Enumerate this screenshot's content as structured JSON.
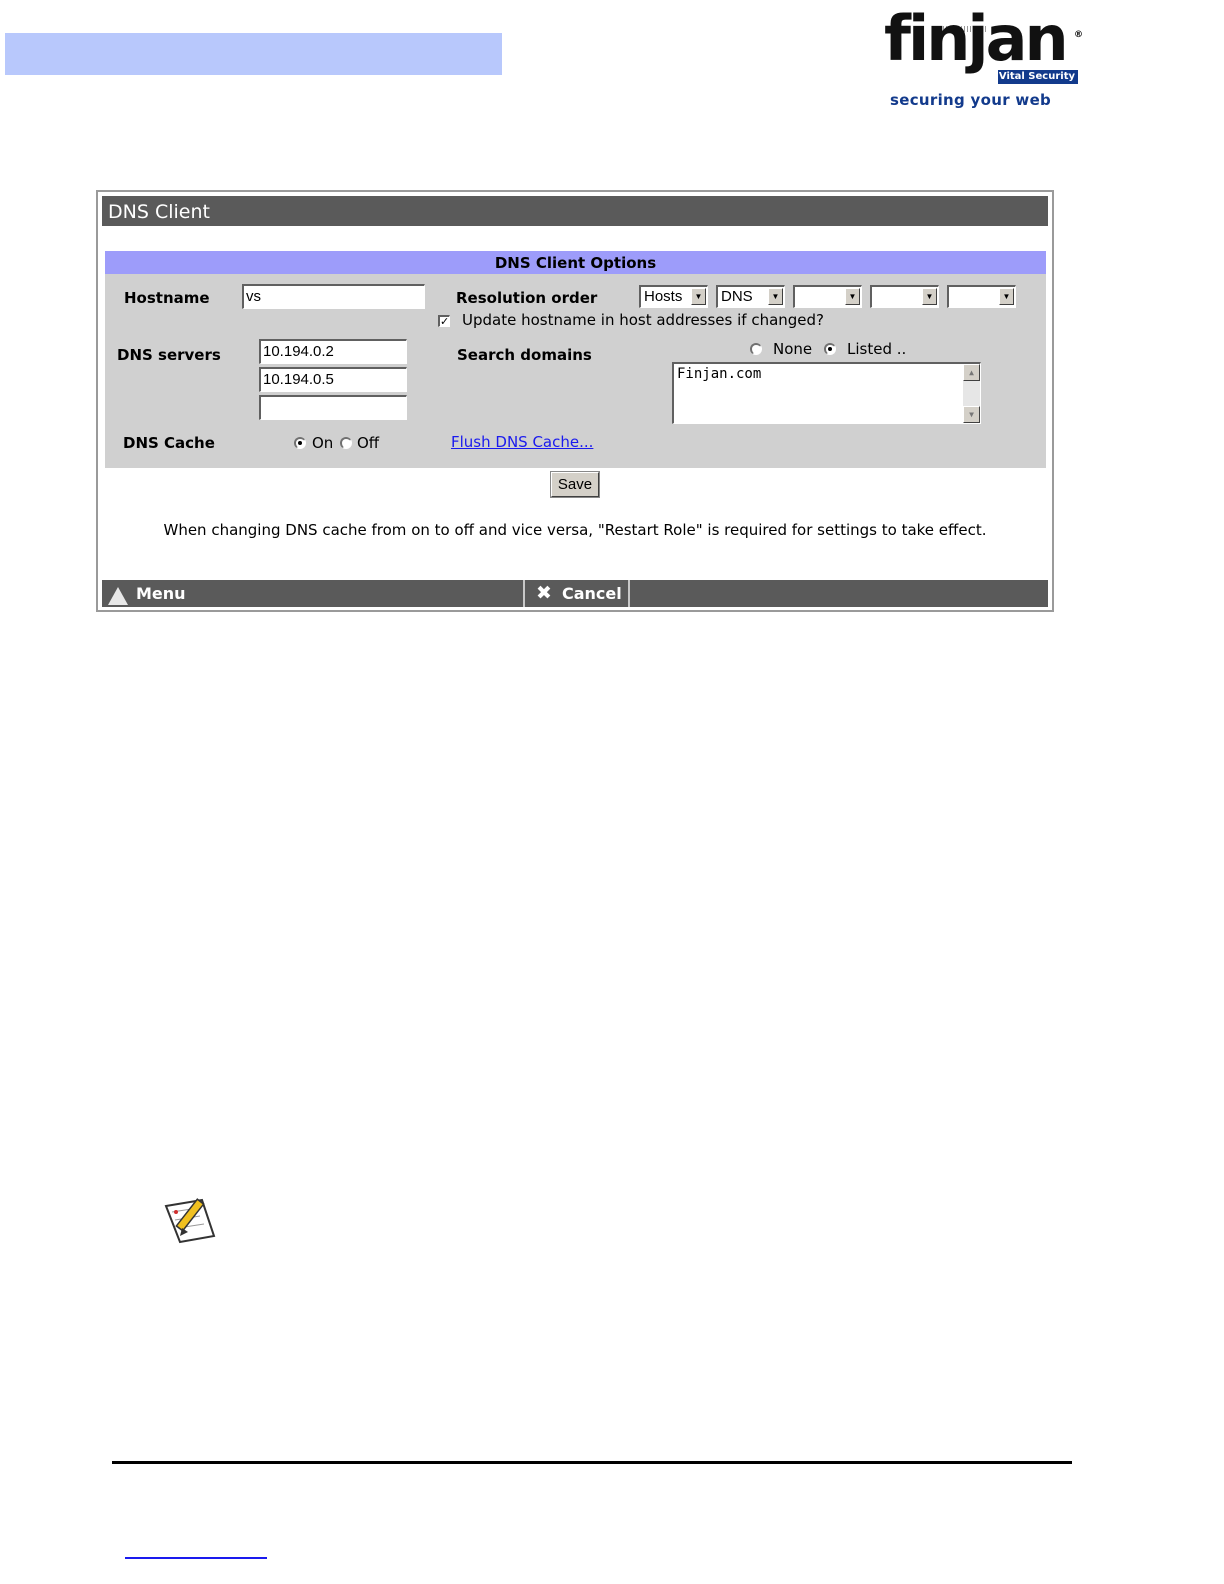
{
  "brand": {
    "name": "finjan",
    "badge": "Vital Security",
    "tagline": "securing your web"
  },
  "dialog": {
    "title": "DNS Client",
    "options_header": "DNS Client Options",
    "hostname": {
      "label": "Hostname",
      "value": "vs"
    },
    "resolution_order": {
      "label": "Resolution order",
      "selects": [
        "Hosts",
        "DNS",
        "",
        "",
        ""
      ]
    },
    "update_hostname": {
      "label": "Update hostname in host addresses if changed?",
      "checked": true
    },
    "dns_servers": {
      "label": "DNS servers",
      "values": [
        "10.194.0.2",
        "10.194.0.5",
        ""
      ]
    },
    "search_domains": {
      "label": "Search domains",
      "radio_none": "None",
      "radio_listed": "Listed ..",
      "selected": "Listed ..",
      "text": "Finjan.com"
    },
    "dns_cache": {
      "label": "DNS Cache",
      "radio_on": "On",
      "radio_off": "Off",
      "selected": "On",
      "flush_link": "Flush DNS Cache..."
    },
    "save_label": "Save",
    "note": "When changing DNS cache from on to off and vice versa, \"Restart Role\" is required for settings to take effect.",
    "bottom_bar": {
      "menu_label": "Menu",
      "cancel_label": "Cancel"
    }
  }
}
